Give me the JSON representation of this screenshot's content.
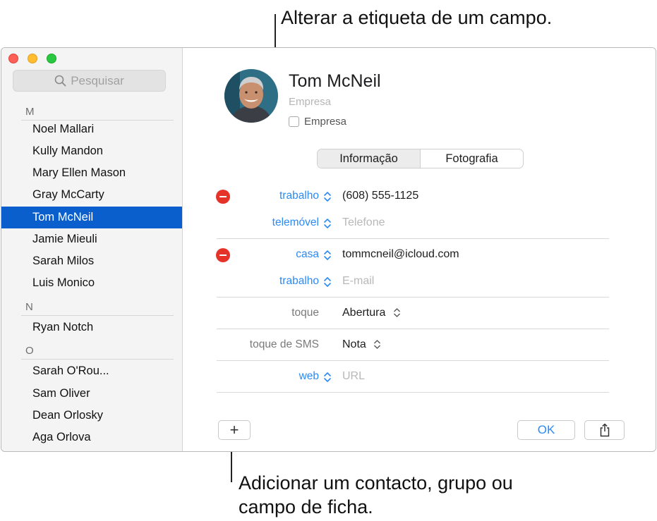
{
  "callouts": {
    "top": "Alterar a etiqueta de um campo.",
    "bottom_line1": "Adicionar um contacto, grupo ou",
    "bottom_line2": "campo de ficha."
  },
  "sidebar": {
    "search_placeholder": "Pesquisar",
    "sections": [
      {
        "letter": "M",
        "contacts": [
          "Noel Mallari",
          "Kully Mandon",
          "Mary Ellen Mason",
          "Gray McCarty",
          "Tom McNeil",
          "Jamie Mieuli",
          "Sarah Milos",
          "Luis Monico"
        ]
      },
      {
        "letter": "N",
        "contacts": [
          "Ryan Notch"
        ]
      },
      {
        "letter": "O",
        "contacts": [
          "Sarah O'Rou...",
          "Sam Oliver",
          "Dean Orlosky",
          "Aga Orlova"
        ]
      }
    ],
    "selected": "Tom McNeil"
  },
  "card": {
    "name": "Tom  McNeil",
    "company_placeholder": "Empresa",
    "company_checkbox_label": "Empresa",
    "tabs": [
      "Informação",
      "Fotografia"
    ],
    "active_tab": "Informação",
    "phone_label": "trabalho",
    "phone_value": "(608) 555-1125",
    "phone2_label": "telemóvel",
    "phone2_placeholder": "Telefone",
    "email_label": "casa",
    "email_value": "tommcneil@icloud.com",
    "email2_label": "trabalho",
    "email2_placeholder": "E-mail",
    "ringtone_label": "toque",
    "ringtone_value": "Abertura",
    "texttone_label": "toque de SMS",
    "texttone_value": "Nota",
    "url_label": "web",
    "url_placeholder": "URL"
  },
  "footer": {
    "add_symbol": "+",
    "ok_label": "OK"
  },
  "colors": {
    "selection": "#0b5fcc",
    "accent_blue": "#2a8af6",
    "delete_red": "#e5332a"
  }
}
